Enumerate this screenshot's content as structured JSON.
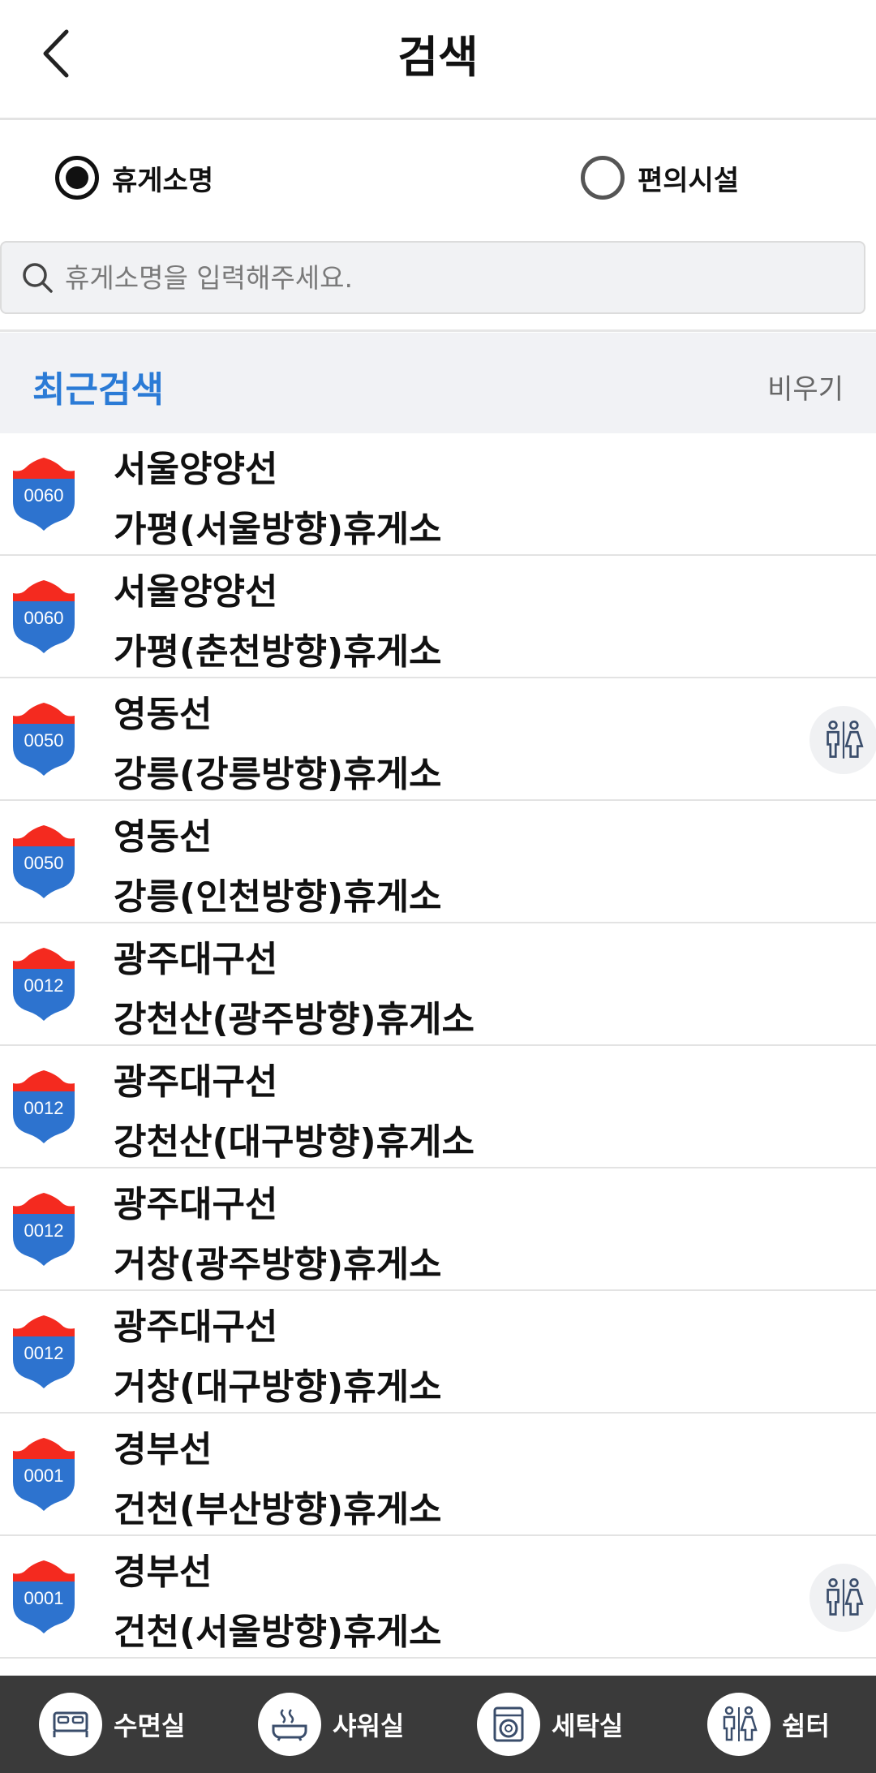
{
  "header": {
    "title": "검색",
    "back_icon": "chevron-left-icon"
  },
  "search_type": {
    "options": [
      {
        "label": "휴게소명",
        "checked": true
      },
      {
        "label": "편의시설",
        "checked": false
      }
    ]
  },
  "search": {
    "placeholder": "휴게소명을 입력해주세요.",
    "value": ""
  },
  "recent": {
    "title": "최근검색",
    "clear_label": "비우기",
    "items": [
      {
        "route_no": "0060",
        "route": "서울양양선",
        "name": "가평(서울방향)휴게소",
        "facility": ""
      },
      {
        "route_no": "0060",
        "route": "서울양양선",
        "name": "가평(춘천방향)휴게소",
        "facility": ""
      },
      {
        "route_no": "0050",
        "route": "영동선",
        "name": "강릉(강릉방향)휴게소",
        "facility": "restroom-icon"
      },
      {
        "route_no": "0050",
        "route": "영동선",
        "name": "강릉(인천방향)휴게소",
        "facility": ""
      },
      {
        "route_no": "0012",
        "route": "광주대구선",
        "name": "강천산(광주방향)휴게소",
        "facility": ""
      },
      {
        "route_no": "0012",
        "route": "광주대구선",
        "name": "강천산(대구방향)휴게소",
        "facility": ""
      },
      {
        "route_no": "0012",
        "route": "광주대구선",
        "name": "거창(광주방향)휴게소",
        "facility": ""
      },
      {
        "route_no": "0012",
        "route": "광주대구선",
        "name": "거창(대구방향)휴게소",
        "facility": ""
      },
      {
        "route_no": "0001",
        "route": "경부선",
        "name": "건천(부산방향)휴게소",
        "facility": ""
      },
      {
        "route_no": "0001",
        "route": "경부선",
        "name": "건천(서울방향)휴게소",
        "facility": "restroom-icon"
      }
    ]
  },
  "tabs": [
    {
      "label": "수면실",
      "icon": "bed-icon"
    },
    {
      "label": "샤워실",
      "icon": "bathtub-icon"
    },
    {
      "label": "세탁실",
      "icon": "washing-machine-icon"
    },
    {
      "label": "쉼터",
      "icon": "restroom-icon"
    }
  ],
  "colors": {
    "accent": "#2b7bd6",
    "shield_red": "#f42a1f",
    "shield_blue": "#2d73cf",
    "tabbar": "#3a3a3a",
    "section_bg": "#f1f2f5"
  }
}
